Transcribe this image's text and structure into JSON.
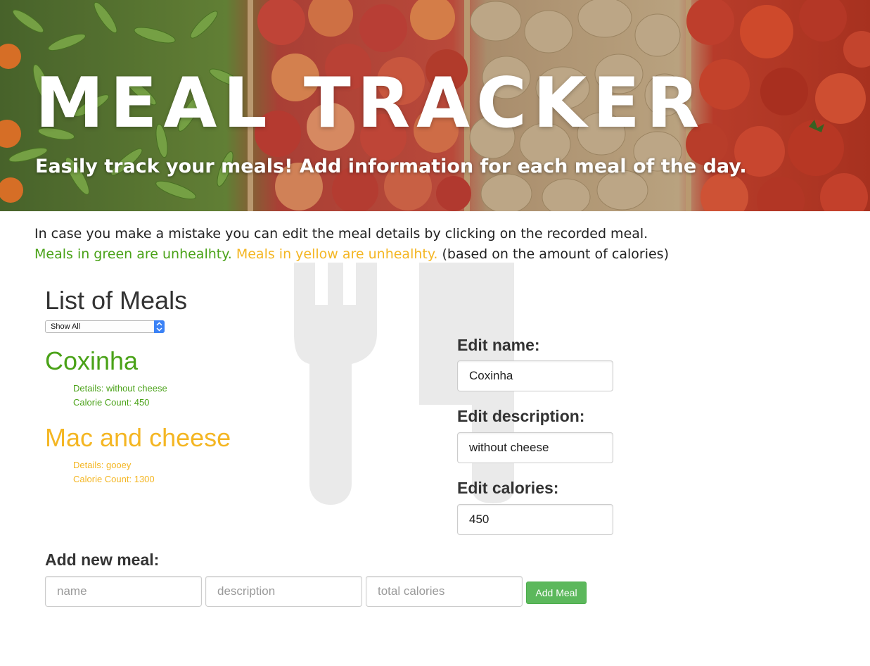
{
  "header": {
    "title": "MEAL TRACKER",
    "subtitle": "Easily track your meals! Add information for each meal of the day."
  },
  "intro": {
    "line1": "In case you make a mistake you can edit the meal details by clicking on the recorded meal.",
    "green_note": "Meals in green are unhealhty.",
    "yellow_note": "Meals in yellow are unhealhty.",
    "suffix": "(based on the amount of calories)"
  },
  "list": {
    "title": "List of Meals",
    "filter_selected": "Show All",
    "meals": [
      {
        "name": "Coxinha",
        "details": "Details: without cheese",
        "calories": "Calorie Count: 450",
        "color": "#4aa218"
      },
      {
        "name": "Mac and cheese",
        "details": "Details: gooey",
        "calories": "Calorie Count: 1300",
        "color": "#f4b623"
      }
    ]
  },
  "edit": {
    "name_label": "Edit name:",
    "name_value": "Coxinha",
    "description_label": "Edit description:",
    "description_value": "without cheese",
    "calories_label": "Edit calories:",
    "calories_value": "450"
  },
  "add": {
    "title": "Add new meal:",
    "name_placeholder": "name",
    "description_placeholder": "description",
    "calories_placeholder": "total calories",
    "button_label": "Add Meal"
  },
  "colors": {
    "healthy_green": "#4aa218",
    "yellow": "#f4b623",
    "button_green": "#5cb85c"
  },
  "icons": {
    "background": "fork-knife-icon"
  }
}
